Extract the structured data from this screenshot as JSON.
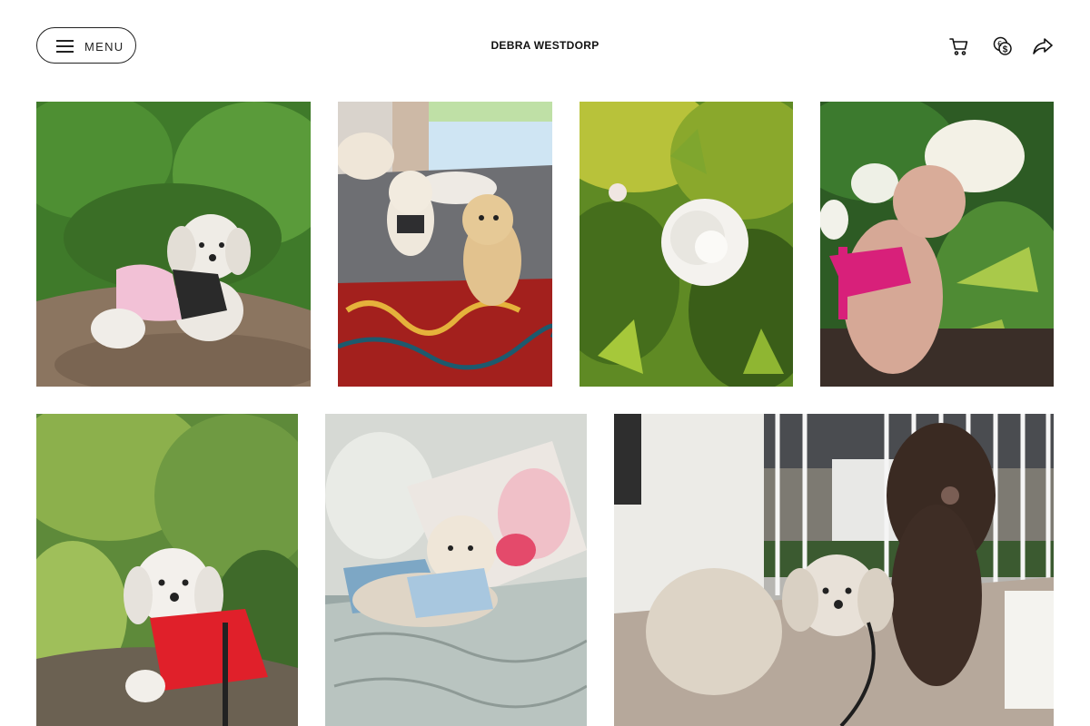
{
  "header": {
    "menu_label": "MENU",
    "site_title": "DEBRA WESTDORP",
    "icons": [
      "cart-icon",
      "currency-icon",
      "share-icon"
    ]
  },
  "gallery": {
    "rows": [
      [
        "white-dog-pink-sweater-on-stump",
        "two-dogs-on-paisley-bed",
        "white-rose-among-leaves",
        "apricot-dog-pink-harness-by-hydrangea"
      ],
      [
        "white-dog-red-shirt-under-cedar",
        "white-dog-on-pillows-with-blanket",
        "two-dogs-on-porch"
      ]
    ]
  },
  "colors": {
    "text": "#111111",
    "border": "#222222",
    "background": "#ffffff"
  }
}
